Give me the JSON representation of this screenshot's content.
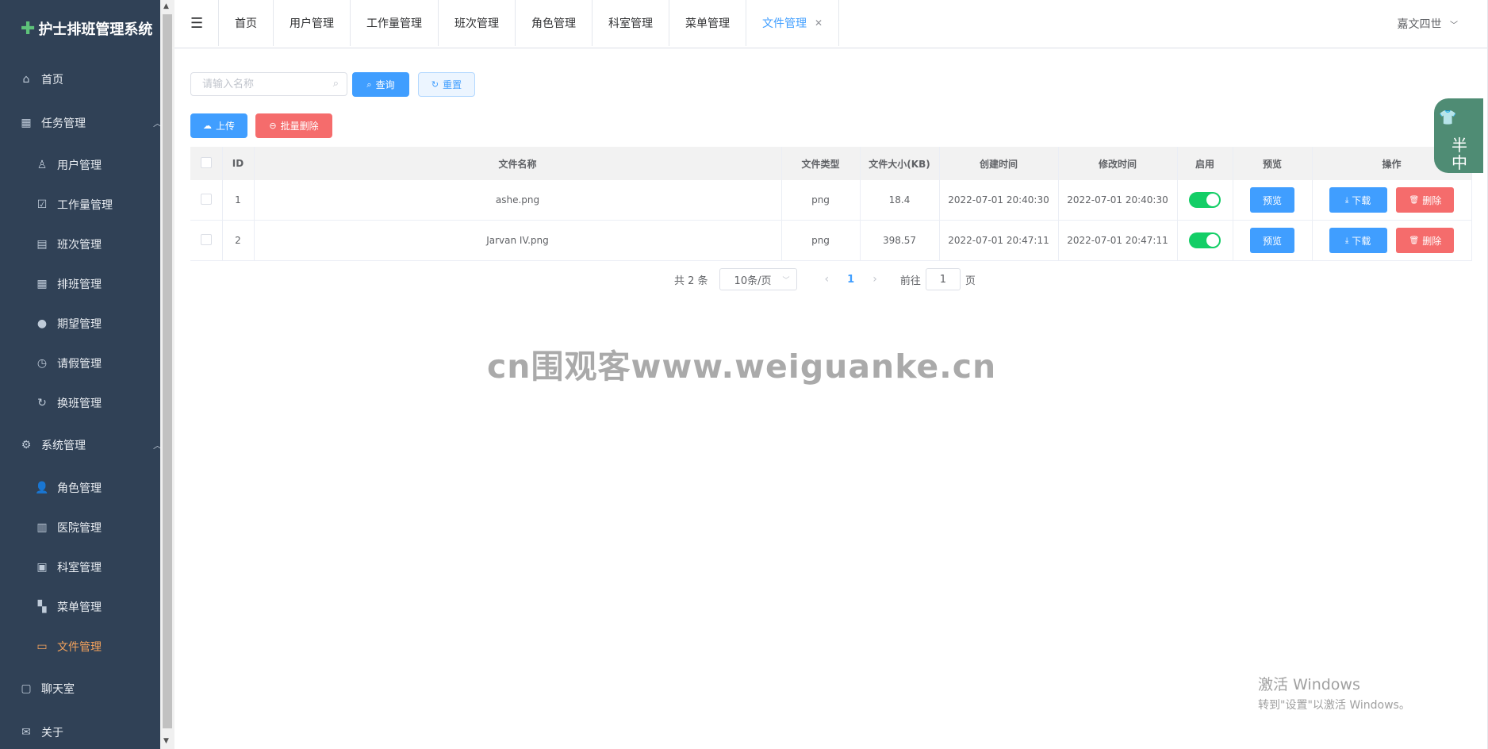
{
  "app": {
    "title": "护士排班管理系统"
  },
  "sidebar": {
    "items": [
      {
        "label": "首页",
        "icon": "home-icon"
      },
      {
        "label": "任务管理",
        "icon": "grid-icon",
        "expanded": true
      },
      {
        "label": "用户管理",
        "icon": "user-outline-icon"
      },
      {
        "label": "工作量管理",
        "icon": "clipboard-check-icon"
      },
      {
        "label": "班次管理",
        "icon": "clipboard-icon"
      },
      {
        "label": "排班管理",
        "icon": "calendar-icon"
      },
      {
        "label": "期望管理",
        "icon": "location-pin-icon"
      },
      {
        "label": "请假管理",
        "icon": "clock-icon"
      },
      {
        "label": "换班管理",
        "icon": "refresh-icon"
      },
      {
        "label": "系统管理",
        "icon": "gear-icon",
        "expanded": true
      },
      {
        "label": "角色管理",
        "icon": "user-solid-icon"
      },
      {
        "label": "医院管理",
        "icon": "building-icon"
      },
      {
        "label": "科室管理",
        "icon": "office-building-icon"
      },
      {
        "label": "菜单管理",
        "icon": "menu-grid-icon"
      },
      {
        "label": "文件管理",
        "icon": "folder-icon",
        "active": true
      },
      {
        "label": "聊天室",
        "icon": "chat-icon"
      },
      {
        "label": "关于",
        "icon": "mail-icon"
      }
    ]
  },
  "tabs": [
    {
      "label": "首页"
    },
    {
      "label": "用户管理"
    },
    {
      "label": "工作量管理"
    },
    {
      "label": "班次管理"
    },
    {
      "label": "角色管理"
    },
    {
      "label": "科室管理"
    },
    {
      "label": "菜单管理"
    },
    {
      "label": "文件管理",
      "active": true,
      "closable": true
    }
  ],
  "user": {
    "name": "嘉文四世"
  },
  "search": {
    "placeholder": "请输入名称",
    "value": ""
  },
  "buttons": {
    "query": "查询",
    "reset": "重置",
    "upload": "上传",
    "batch_delete": "批量删除"
  },
  "table": {
    "columns": [
      "ID",
      "文件名称",
      "文件类型",
      "文件大小(KB)",
      "创建时间",
      "修改时间",
      "启用",
      "预览",
      "操作"
    ],
    "rows": [
      {
        "id": "1",
        "name": "ashe.png",
        "type": "png",
        "size": "18.4",
        "created": "2022-07-01 20:40:30",
        "modified": "2022-07-01 20:40:30",
        "enabled": true
      },
      {
        "id": "2",
        "name": "Jarvan IV.png",
        "type": "png",
        "size": "398.57",
        "created": "2022-07-01 20:47:11",
        "modified": "2022-07-01 20:47:11",
        "enabled": true
      }
    ],
    "preview_label": "预览",
    "download_label": "下载",
    "delete_label": "删除"
  },
  "pagination": {
    "total_text": "共 2 条",
    "page_size": "10条/页",
    "current": "1",
    "goto_prefix": "前往",
    "goto_value": "1",
    "goto_suffix": "页"
  },
  "watermark": "cn围观客www.weiguanke.cn",
  "windows_activation": {
    "line1": "激活 Windows",
    "line2": "转到\"设置\"以激活 Windows。"
  },
  "float_widget": {
    "text": "半\n中"
  },
  "colors": {
    "sidebar_bg": "#304156",
    "active_menu": "#f5a35c",
    "primary": "#409eff",
    "danger": "#f56c6c",
    "switch_on": "#13ce66"
  }
}
